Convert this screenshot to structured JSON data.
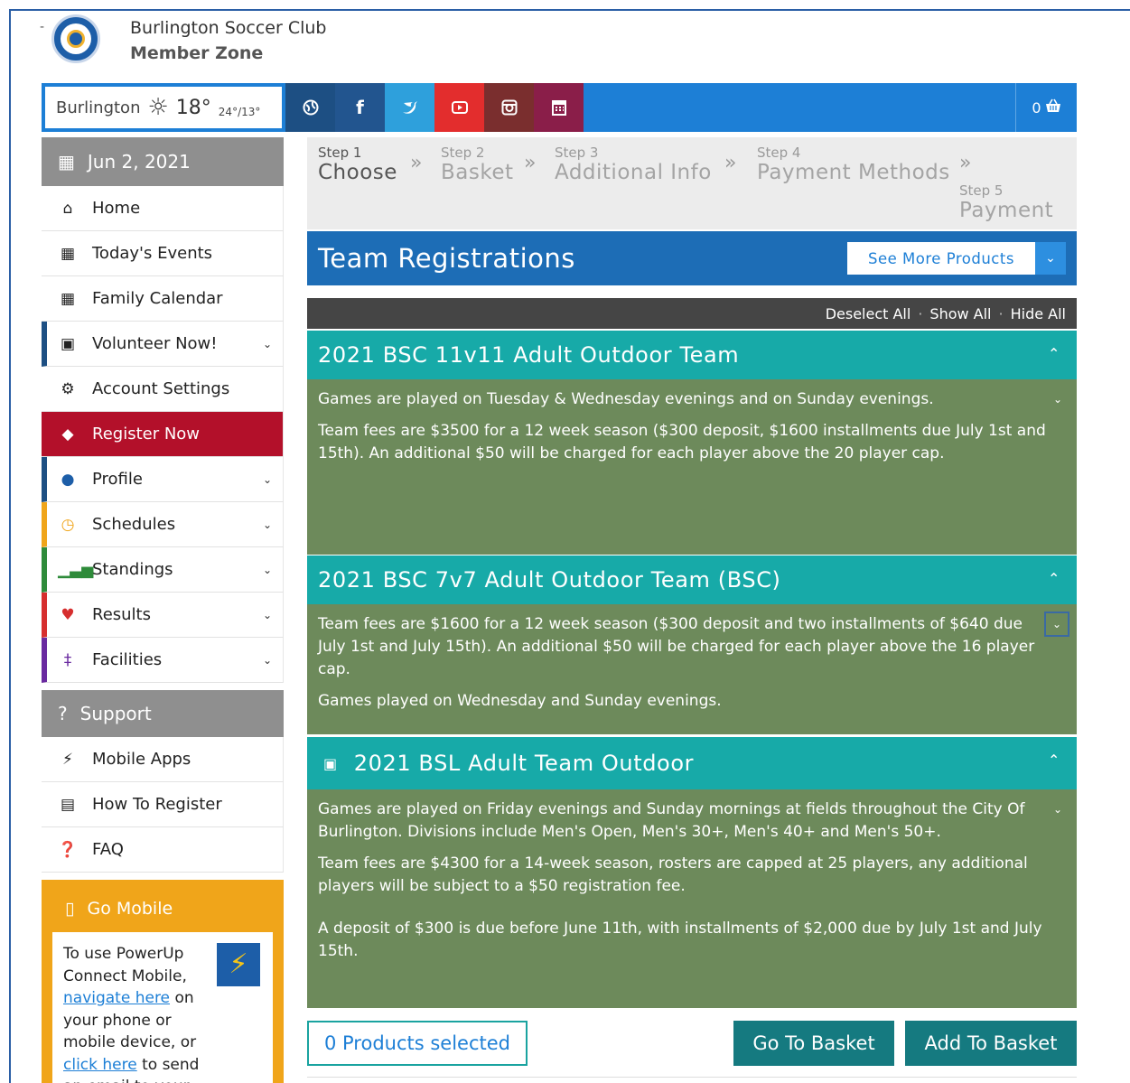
{
  "header": {
    "club_name": "Burlington Soccer Club",
    "zone_name": "Member Zone",
    "logo_dash": "-"
  },
  "topbar": {
    "weather": {
      "city": "Burlington",
      "temp": "18°",
      "range": "24°/13°",
      "icon": "sun-icon"
    },
    "social": [
      {
        "name": "globe-icon",
        "color": "#1d4f83"
      },
      {
        "name": "facebook-icon",
        "color": "#22558f"
      },
      {
        "name": "twitter-icon",
        "color": "#2ea0dc"
      },
      {
        "name": "youtube-icon",
        "color": "#e32d2d"
      },
      {
        "name": "instagram-icon",
        "color": "#7a2e2e"
      },
      {
        "name": "calendar-icon",
        "color": "#8a1e49"
      }
    ],
    "cart_count": "0"
  },
  "sidebar": {
    "date": "Jun 2, 2021",
    "items": [
      {
        "label": "Home",
        "icon": "home-icon"
      },
      {
        "label": "Today's Events",
        "icon": "calendar-icon"
      },
      {
        "label": "Family Calendar",
        "icon": "calendar-icon"
      },
      {
        "label": "Volunteer Now!",
        "icon": "volunteer-icon",
        "accent": "#1d4f83",
        "chevron": true
      },
      {
        "label": "Account Settings",
        "icon": "gear-icon"
      },
      {
        "label": "Register Now",
        "icon": "tag-icon",
        "active": true
      },
      {
        "label": "Profile",
        "icon": "user-icon",
        "accent": "#1d4f83",
        "chevron": true
      },
      {
        "label": "Schedules",
        "icon": "clock-icon",
        "accent": "#f0a51a",
        "chevron": true
      },
      {
        "label": "Standings",
        "icon": "chart-icon",
        "accent": "#2e8b3a",
        "chevron": true
      },
      {
        "label": "Results",
        "icon": "trophy-icon",
        "accent": "#d62e2e",
        "chevron": true
      },
      {
        "label": "Facilities",
        "icon": "facility-icon",
        "accent": "#6a2aa0",
        "chevron": true
      }
    ],
    "support_label": "Support",
    "support_items": [
      {
        "label": "Mobile Apps",
        "icon": "bolt-icon"
      },
      {
        "label": "How To Register",
        "icon": "pdf-icon"
      },
      {
        "label": "FAQ",
        "icon": "question-icon"
      }
    ],
    "go_mobile": {
      "title": "Go Mobile",
      "text_1": "To use PowerUp Connect Mobile,",
      "link_1": "navigate here",
      "text_2": "on your phone or mobile device, or",
      "link_2": "click here",
      "text_3": "to send an email to your mobile device."
    }
  },
  "steps": [
    {
      "step": "Step 1",
      "name": "Choose"
    },
    {
      "step": "Step 2",
      "name": "Basket"
    },
    {
      "step": "Step 3",
      "name": "Additional Info"
    },
    {
      "step": "Step 4",
      "name": "Payment Methods"
    },
    {
      "step": "Step 5",
      "name": "Payment"
    }
  ],
  "main": {
    "title": "Team Registrations",
    "see_more": "See More Products",
    "deselect_all": "Deselect All",
    "show_all": "Show All",
    "hide_all": "Hide All",
    "products": [
      {
        "title": "2021 BSC 11v11 Adult Outdoor Team",
        "paragraphs": [
          "Games are played on Tuesday & Wednesday evenings and on Sunday evenings.",
          "Team fees are $3500 for a 12 week season ($300 deposit, $1600 installments due July 1st and 15th).  An additional $50 will be charged for each player above the 20 player cap."
        ]
      },
      {
        "title": "2021 BSC 7v7 Adult Outdoor Team (BSC)",
        "paragraphs": [
          "Team fees are $1600 for a 12 week season ($300 deposit and two installments of $640 due July 1st and July 15th). An additional $50 will be charged for each player above the 16 player cap.",
          "Games played on Wednesday and Sunday evenings."
        ]
      },
      {
        "title": "2021 BSL Adult Team Outdoor",
        "paragraphs": [
          "Games are played on Friday evenings and Sunday mornings at fields throughout the City Of Burlington.  Divisions include Men's Open, Men's 30+, Men's 40+ and Men's 50+.",
          "Team fees are $4300 for a 14-week season, rosters are capped at 25 players, any additional players will be subject to a $50 registration fee.",
          "A deposit of $300 is due before June 11th, with installments of $2,000 due by July 1st and July 15th."
        ]
      }
    ],
    "products_selected": "0 Products selected",
    "go_to_basket": "Go To Basket",
    "add_to_basket": "Add To Basket"
  }
}
